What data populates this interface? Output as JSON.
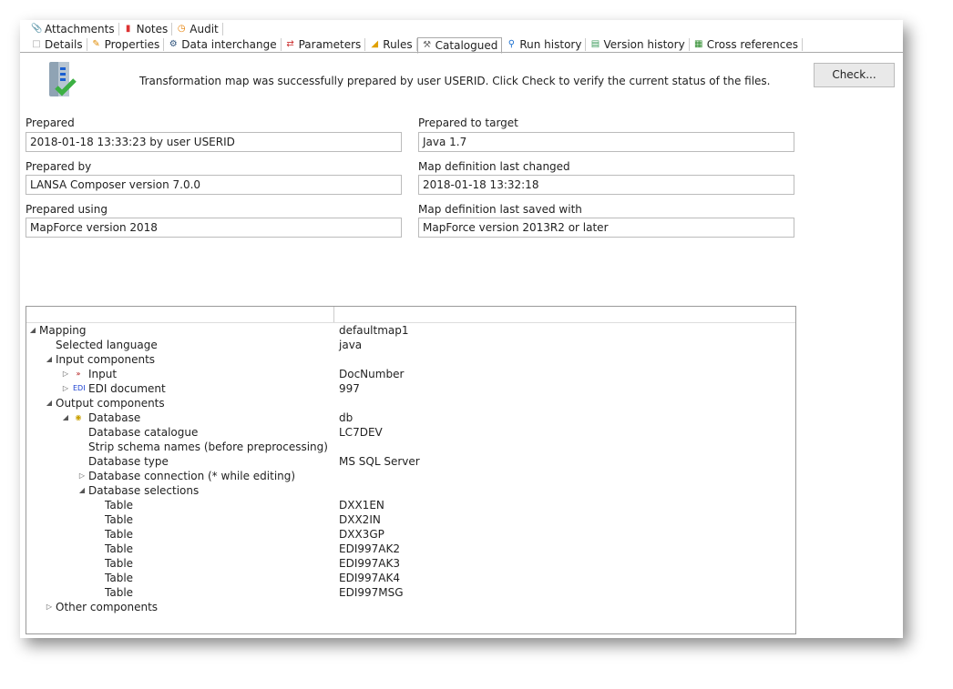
{
  "tabs_row1": [
    {
      "label": "Attachments",
      "icon": "paperclip-icon"
    },
    {
      "label": "Notes",
      "icon": "notes-icon"
    },
    {
      "label": "Audit",
      "icon": "audit-clock-icon"
    }
  ],
  "tabs_row2": [
    {
      "label": "Details",
      "icon": "document-icon"
    },
    {
      "label": "Properties",
      "icon": "pencil-icon"
    },
    {
      "label": "Data interchange",
      "icon": "gears-icon"
    },
    {
      "label": "Parameters",
      "icon": "arrows-icon"
    },
    {
      "label": "Rules",
      "icon": "ruler-icon"
    },
    {
      "label": "Catalogued",
      "icon": "tools-icon",
      "active": true
    },
    {
      "label": "Run history",
      "icon": "magnifier-icon"
    },
    {
      "label": "Version history",
      "icon": "stack-icon"
    },
    {
      "label": "Cross references",
      "icon": "hierarchy-icon"
    }
  ],
  "message": "Transformation map was successfully prepared by user USERID.  Click Check to verify the current status of the files.",
  "check_button": "Check...",
  "fields": {
    "prepared": {
      "label": "Prepared",
      "value": "2018-01-18 13:33:23 by user USERID"
    },
    "prepared_by": {
      "label": "Prepared by",
      "value": "LANSA Composer version 7.0.0"
    },
    "prepared_using": {
      "label": "Prepared using",
      "value": "MapForce version 2018"
    },
    "prepared_to_target": {
      "label": "Prepared to target",
      "value": "Java 1.7"
    },
    "map_changed": {
      "label": "Map definition last changed",
      "value": "2018-01-18 13:32:18"
    },
    "map_saved_with": {
      "label": "Map definition last saved with",
      "value": "MapForce version 2013R2 or later"
    }
  },
  "tree": [
    {
      "level": 0,
      "exp": "open",
      "label": "Mapping",
      "value": "defaultmap1"
    },
    {
      "level": 1,
      "exp": "",
      "label": "Selected language",
      "value": "java"
    },
    {
      "level": 1,
      "exp": "open",
      "label": "Input components",
      "value": ""
    },
    {
      "level": 2,
      "exp": "closed",
      "icon": "input-icon",
      "label": "Input",
      "value": "DocNumber"
    },
    {
      "level": 2,
      "exp": "closed",
      "icon": "edi-icon",
      "label": "EDI document",
      "value": "997"
    },
    {
      "level": 1,
      "exp": "open",
      "label": "Output components",
      "value": ""
    },
    {
      "level": 2,
      "exp": "open",
      "icon": "database-icon",
      "label": "Database",
      "value": "db"
    },
    {
      "level": 3,
      "exp": "",
      "label": "Database catalogue",
      "value": "LC7DEV"
    },
    {
      "level": 3,
      "exp": "",
      "label": "Strip schema names (before preprocessing)",
      "value": ""
    },
    {
      "level": 3,
      "exp": "",
      "label": "Database type",
      "value": "MS SQL Server"
    },
    {
      "level": 3,
      "exp": "closed",
      "label": "Database connection (* while editing)",
      "value": ""
    },
    {
      "level": 3,
      "exp": "open",
      "label": "Database selections",
      "value": ""
    },
    {
      "level": 4,
      "exp": "",
      "label": "Table",
      "value": "DXX1EN"
    },
    {
      "level": 4,
      "exp": "",
      "label": "Table",
      "value": "DXX2IN"
    },
    {
      "level": 4,
      "exp": "",
      "label": "Table",
      "value": "DXX3GP"
    },
    {
      "level": 4,
      "exp": "",
      "label": "Table",
      "value": "EDI997AK2"
    },
    {
      "level": 4,
      "exp": "",
      "label": "Table",
      "value": "EDI997AK3"
    },
    {
      "level": 4,
      "exp": "",
      "label": "Table",
      "value": "EDI997AK4"
    },
    {
      "level": 4,
      "exp": "",
      "label": "Table",
      "value": "EDI997MSG"
    },
    {
      "level": 1,
      "exp": "closed",
      "label": "Other components",
      "value": ""
    }
  ]
}
